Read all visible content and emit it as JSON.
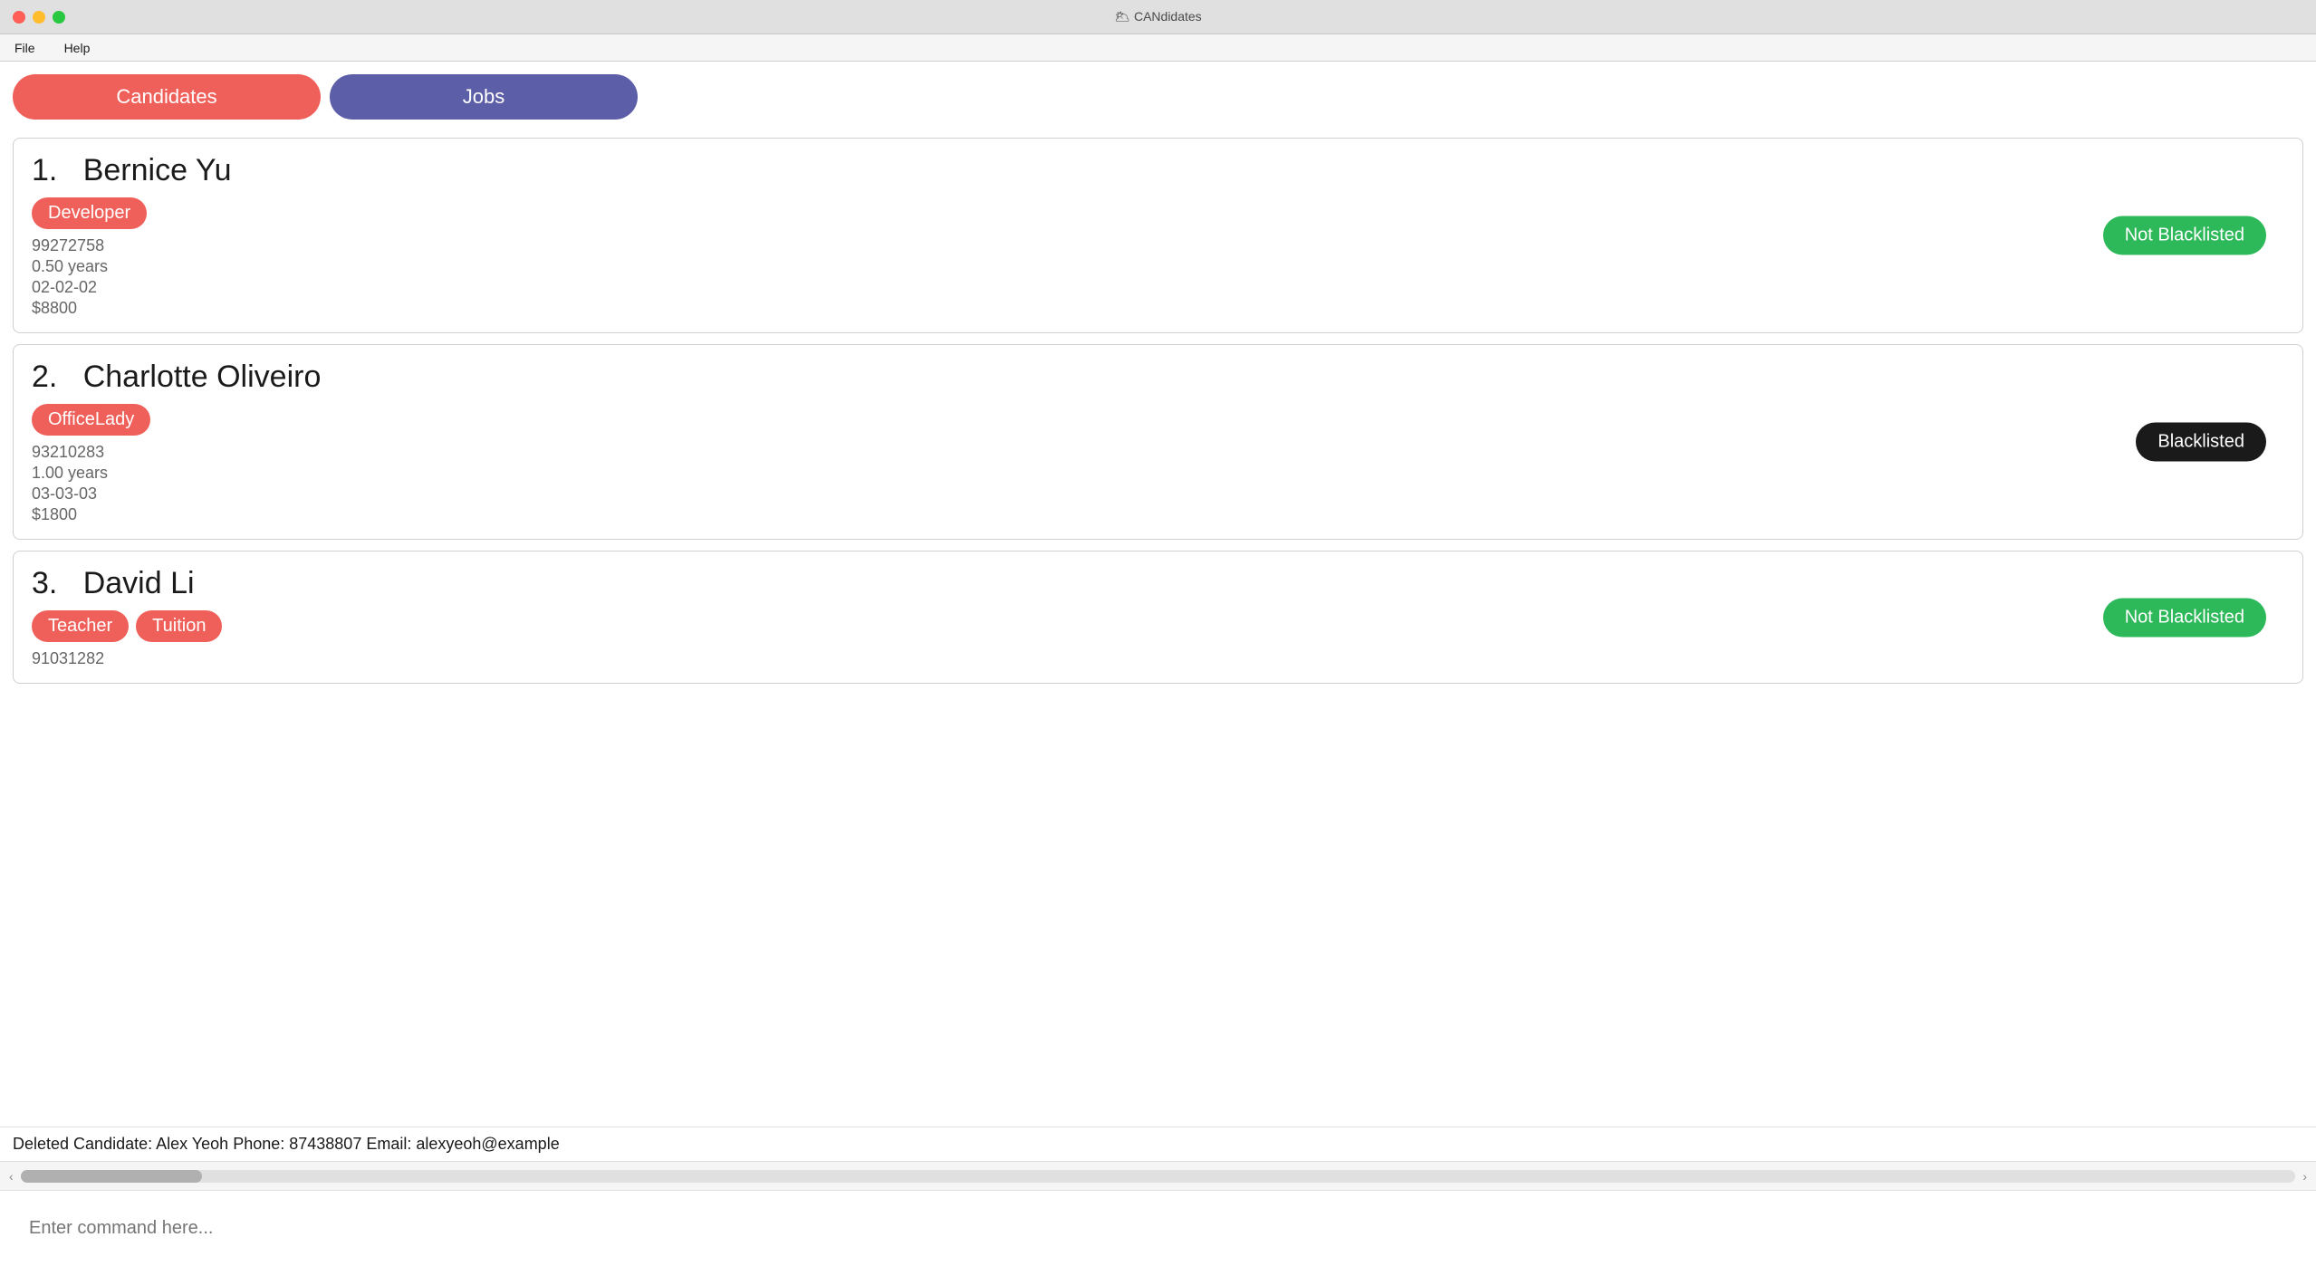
{
  "titleBar": {
    "title": "🌥 CANdidates",
    "buttons": {
      "close": "close",
      "minimize": "minimize",
      "maximize": "maximize"
    }
  },
  "menuBar": {
    "items": [
      "File",
      "Help"
    ]
  },
  "tabs": [
    {
      "id": "candidates",
      "label": "Candidates",
      "active": true
    },
    {
      "id": "jobs",
      "label": "Jobs",
      "active": false
    }
  ],
  "candidates": [
    {
      "number": "1.",
      "name": "Bernice Yu",
      "tags": [
        "Developer"
      ],
      "blacklistStatus": "Not Blacklisted",
      "blacklisted": false,
      "phone": "99272758",
      "experience": "0.50 years",
      "dob": "02-02-02",
      "salary": "$8800"
    },
    {
      "number": "2.",
      "name": "Charlotte Oliveiro",
      "tags": [
        "OfficeLady"
      ],
      "blacklistStatus": "Blacklisted",
      "blacklisted": true,
      "phone": "93210283",
      "experience": "1.00 years",
      "dob": "03-03-03",
      "salary": "$1800"
    },
    {
      "number": "3.",
      "name": "David Li",
      "tags": [
        "Teacher",
        "Tuition"
      ],
      "blacklistStatus": "Not Blacklisted",
      "blacklisted": false,
      "phone": "91031282",
      "experience": "",
      "dob": "",
      "salary": ""
    }
  ],
  "statusBar": {
    "text": "Deleted Candidate: Alex Yeoh Phone: 87438807 Email: alexyeoh@example"
  },
  "commandInput": {
    "placeholder": "Enter command here..."
  }
}
